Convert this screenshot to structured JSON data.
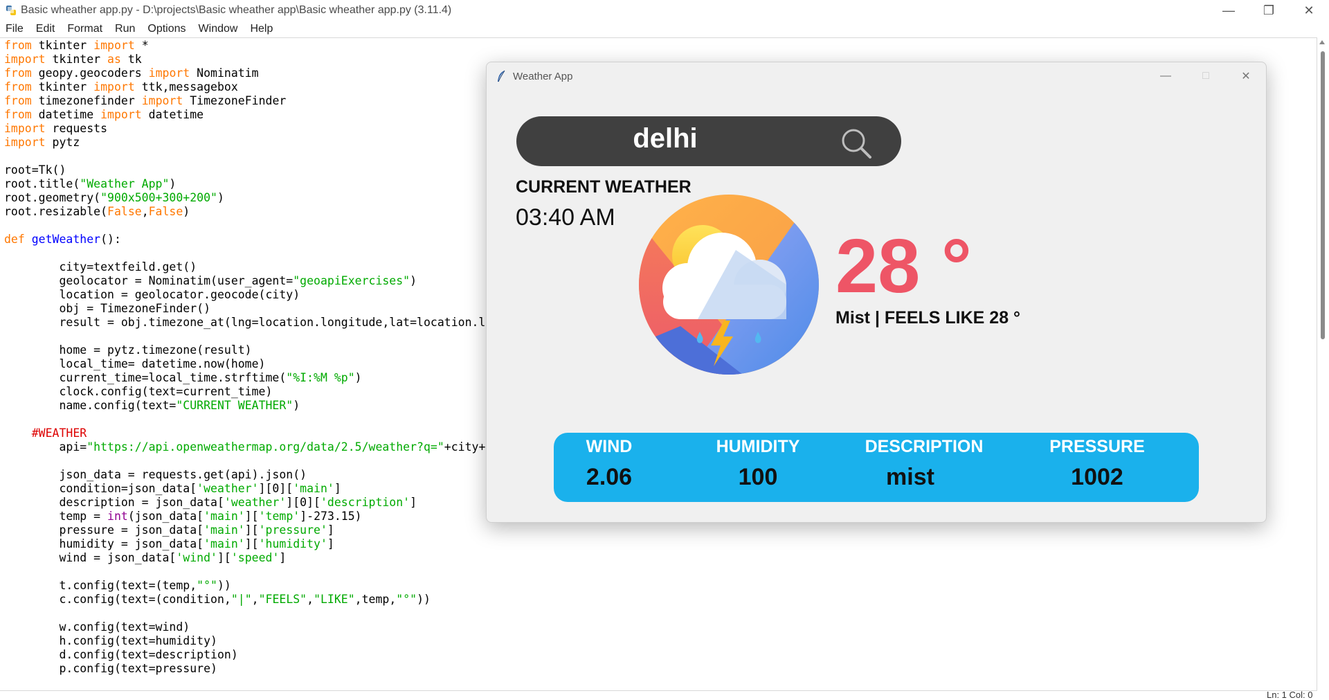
{
  "idle": {
    "title": "Basic wheather app.py - D:\\projects\\Basic wheather app\\Basic wheather app.py (3.11.4)",
    "menu": [
      "File",
      "Edit",
      "Format",
      "Run",
      "Options",
      "Window",
      "Help"
    ],
    "status": "Ln: 1   Col: 0"
  },
  "code": {
    "l1": [
      "from",
      " tkinter ",
      "import",
      " *"
    ],
    "l2": [
      "import",
      " tkinter ",
      "as",
      " tk"
    ],
    "l3": [
      "from",
      " geopy.geocoders ",
      "import",
      " Nominatim"
    ],
    "l4": [
      "from",
      " tkinter ",
      "import",
      " ttk,messagebox"
    ],
    "l5": [
      "from",
      " timezonefinder ",
      "import",
      " TimezoneFinder"
    ],
    "l6": [
      "from",
      " datetime ",
      "import",
      " datetime"
    ],
    "l7": [
      "import",
      " requests"
    ],
    "l8": [
      "import",
      " pytz"
    ],
    "l10": "root=Tk()",
    "l11": [
      "root.title(",
      "\"Weather App\"",
      ")"
    ],
    "l12": [
      "root.geometry(",
      "\"900x500+300+200\"",
      ")"
    ],
    "l13": [
      "root.resizable(",
      "False",
      ",",
      "False",
      ")"
    ],
    "l15": [
      "def",
      " ",
      "getWeather",
      "():"
    ],
    "l17": "        city=textfeild.get()",
    "l18": [
      "        geolocator = Nominatim(user_agent=",
      "\"geoapiExercises\"",
      ")"
    ],
    "l19": "        location = geolocator.geocode(city)",
    "l20": "        obj = TimezoneFinder()",
    "l21": "        result = obj.timezone_at(lng=location.longitude,lat=location.l",
    "l23": "        home = pytz.timezone(result)",
    "l24": "        local_time= datetime.now(home)",
    "l25": [
      "        current_time=local_time.strftime(",
      "\"%I:%M %p\"",
      ")"
    ],
    "l26": "        clock.config(text=current_time)",
    "l27": [
      "        name.config(text=",
      "\"CURRENT WEATHER\"",
      ")"
    ],
    "l29": "    #WEATHER",
    "l30": [
      "        api=",
      "\"https://api.openweathermap.org/data/2.5/weather?q=\"",
      "+city+"
    ],
    "l32": "        json_data = requests.get(api).json()",
    "l33": [
      "        condition=json_data[",
      "'weather'",
      "][0][",
      "'main'",
      "]"
    ],
    "l34": [
      "        description = json_data[",
      "'weather'",
      "][0][",
      "'description'",
      "]"
    ],
    "l35": [
      "        temp = ",
      "int",
      "(json_data[",
      "'main'",
      "][",
      "'temp'",
      "]-273.15)"
    ],
    "l36": [
      "        pressure = json_data[",
      "'main'",
      "][",
      "'pressure'",
      "]"
    ],
    "l37": [
      "        humidity = json_data[",
      "'main'",
      "][",
      "'humidity'",
      "]"
    ],
    "l38": [
      "        wind = json_data[",
      "'wind'",
      "][",
      "'speed'",
      "]"
    ],
    "l40": [
      "        t.config(text=(temp,",
      "\"°\"",
      "))"
    ],
    "l41": [
      "        c.config(text=(condition,",
      "\"|\"",
      ",",
      "\"FEELS\"",
      ",",
      "\"LIKE\"",
      ",temp,",
      "\"°\"",
      "))"
    ],
    "l43": "        w.config(text=wind)",
    "l44": "        h.config(text=humidity)",
    "l45": "        d.config(text=description)",
    "l46": "        p.config(text=pressure)"
  },
  "weather_app": {
    "title": "Weather App",
    "search_value": "delhi",
    "current_weather_label": "CURRENT WEATHER",
    "clock": "03:40 AM",
    "temperature": "28 °",
    "condition": "Mist | FEELS LIKE 28 °",
    "info": {
      "wind_label": "WIND",
      "wind_value": "2.06",
      "humidity_label": "HUMIDITY",
      "humidity_value": "100",
      "description_label": "DESCRIPTION",
      "description_value": "mist",
      "pressure_label": "PRESSURE",
      "pressure_value": "1002"
    },
    "colors": {
      "search_bg": "#404040",
      "temp": "#ee5566",
      "info_bar": "#1ab1ec"
    }
  }
}
